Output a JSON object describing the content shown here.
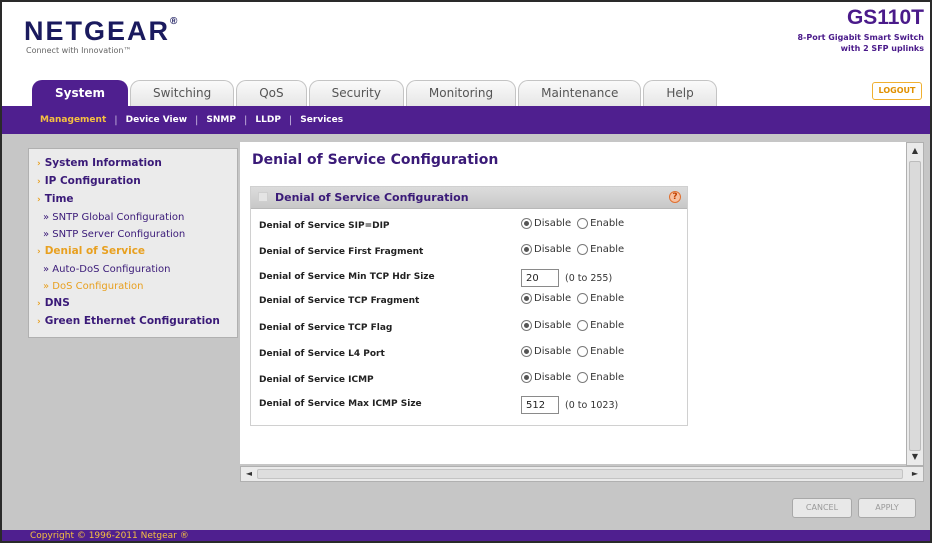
{
  "header": {
    "logo": "NETGEAR",
    "logo_mark": "®",
    "tagline": "Connect with Innovation™",
    "model": "GS110T",
    "model_desc": "8-Port Gigabit Smart Switch with 2 SFP uplinks"
  },
  "tabs": [
    {
      "label": "System",
      "active": true
    },
    {
      "label": "Switching",
      "active": false
    },
    {
      "label": "QoS",
      "active": false
    },
    {
      "label": "Security",
      "active": false
    },
    {
      "label": "Monitoring",
      "active": false
    },
    {
      "label": "Maintenance",
      "active": false
    },
    {
      "label": "Help",
      "active": false
    }
  ],
  "logout_label": "LOGOUT",
  "subnav": [
    {
      "label": "Management",
      "active": true
    },
    {
      "label": "Device View",
      "active": false
    },
    {
      "label": "SNMP",
      "active": false
    },
    {
      "label": "LLDP",
      "active": false
    },
    {
      "label": "Services",
      "active": false
    }
  ],
  "subnav_sep": "|",
  "sidenav": {
    "arrow": "›",
    "items": [
      {
        "label": "System Information"
      },
      {
        "label": "IP Configuration"
      },
      {
        "label": "Time"
      },
      {
        "label": "» SNTP Global Configuration"
      },
      {
        "label": "» SNTP Server Configuration"
      },
      {
        "label": "Denial of Service"
      },
      {
        "label": "» Auto-DoS Configuration"
      },
      {
        "label": "» DoS Configuration"
      },
      {
        "label": "DNS"
      },
      {
        "label": "Green Ethernet Configuration"
      }
    ]
  },
  "main": {
    "page_title": "Denial of Service Configuration",
    "box_title": "Denial of Service Configuration",
    "help_glyph": "?",
    "radio_labels": {
      "disable": "Disable",
      "enable": "Enable"
    },
    "rows": [
      {
        "label": "Denial of Service SIP=DIP",
        "value": "Disable"
      },
      {
        "label": "Denial of Service First Fragment",
        "value": "Disable"
      },
      {
        "label": "Denial of Service Min TCP Hdr Size",
        "value": "20",
        "range": "(0 to 255)"
      },
      {
        "label": "Denial of Service TCP Fragment",
        "value": "Disable"
      },
      {
        "label": "Denial of Service TCP Flag",
        "value": "Disable"
      },
      {
        "label": "Denial of Service L4 Port",
        "value": "Disable"
      },
      {
        "label": "Denial of Service ICMP",
        "value": "Disable"
      },
      {
        "label": "Denial of Service Max ICMP Size",
        "value": "512",
        "range": "(0 to 1023)"
      }
    ]
  },
  "scroll": {
    "up": "▲",
    "down": "▼",
    "left": "◄",
    "right": "►"
  },
  "buttons": {
    "cancel": "CANCEL",
    "apply": "APPLY"
  },
  "footer": {
    "copyright": "Copyright © 1996-2011 Netgear ®"
  }
}
